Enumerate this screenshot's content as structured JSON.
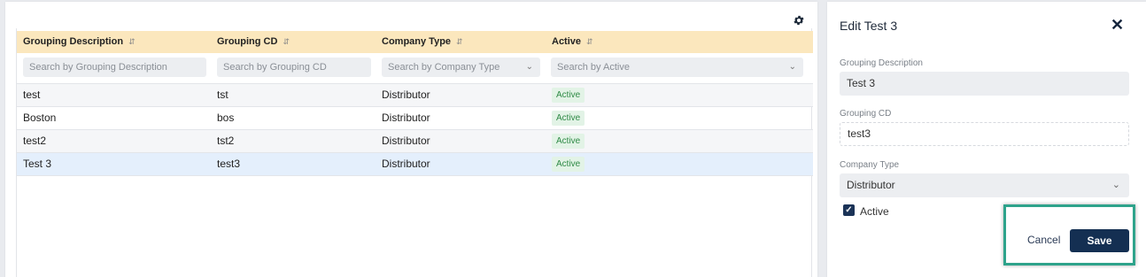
{
  "grid": {
    "gear_icon": "gear-icon",
    "columns": [
      {
        "label": "Grouping Description",
        "sort_icon": "sort-icon"
      },
      {
        "label": "Grouping CD",
        "sort_icon": "sort-icon"
      },
      {
        "label": "Company Type",
        "sort_icon": "sort-icon"
      },
      {
        "label": "Active",
        "sort_icon": "sort-icon"
      }
    ],
    "filters": [
      {
        "placeholder": "Search by Grouping Description"
      },
      {
        "placeholder": "Search by Grouping CD"
      },
      {
        "placeholder": "Search by Company Type",
        "icon": "chevron-down-icon"
      },
      {
        "placeholder": "Search by Active",
        "icon": "chevron-down-icon"
      }
    ],
    "rows": [
      {
        "description": "test",
        "cd": "tst",
        "company_type": "Distributor",
        "active": "Active"
      },
      {
        "description": "Boston",
        "cd": "bos",
        "company_type": "Distributor",
        "active": "Active"
      },
      {
        "description": "test2",
        "cd": "tst2",
        "company_type": "Distributor",
        "active": "Active"
      },
      {
        "description": "Test 3",
        "cd": "test3",
        "company_type": "Distributor",
        "active": "Active"
      }
    ],
    "selected_row": "Test 3",
    "badge_color": "#2f8a46"
  },
  "panel": {
    "title": "Edit Test 3",
    "close_icon": "close-icon",
    "fields": {
      "description": {
        "label": "Grouping Description",
        "value": "Test 3"
      },
      "cd": {
        "label": "Grouping CD",
        "value": "test3"
      },
      "company_type": {
        "label": "Company Type",
        "value": "Distributor"
      }
    },
    "active": {
      "label": "Active",
      "checked": true
    },
    "cancel_label": "Cancel",
    "save_label": "Save",
    "accent": "#142f52",
    "highlight_color": "#2ea38b"
  }
}
